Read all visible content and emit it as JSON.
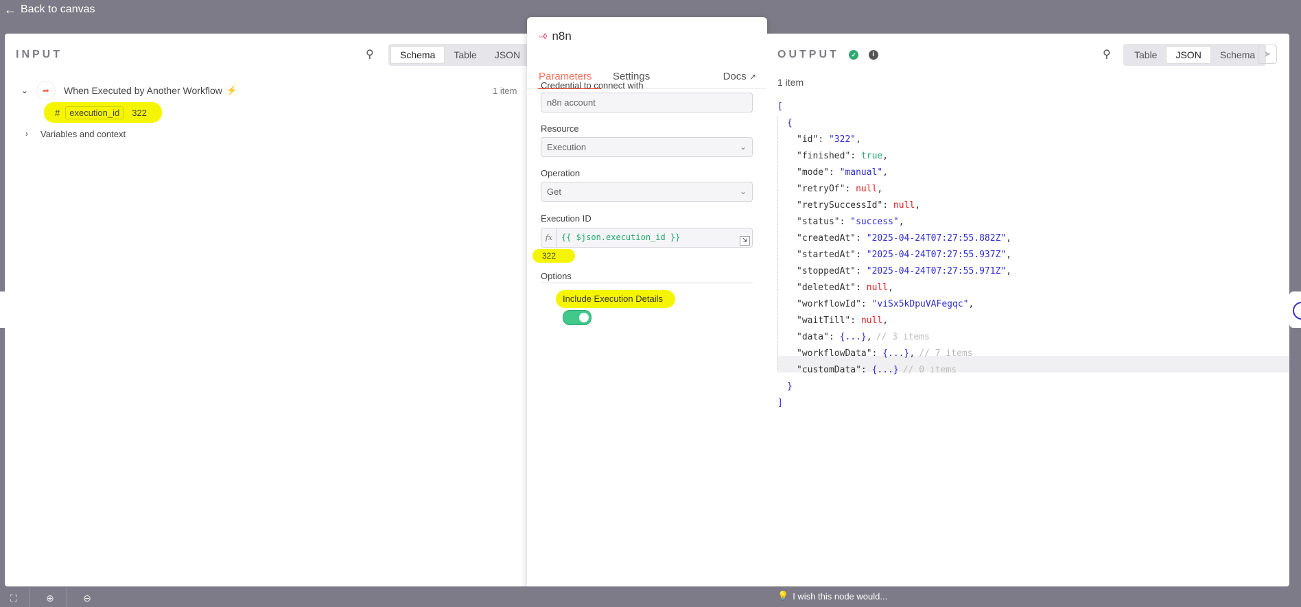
{
  "header": {
    "back_label": "Back to canvas"
  },
  "input": {
    "title": "INPUT",
    "views": [
      "Schema",
      "Table",
      "JSON"
    ],
    "active_view": "Schema",
    "trigger_name": "When Executed by Another Workflow",
    "item_count": "1 item",
    "field_type_glyph": "#",
    "field_name": "execution_id",
    "field_value": "322",
    "variables_label": "Variables and context"
  },
  "node": {
    "name": "n8n",
    "tabs": [
      "Parameters",
      "Settings"
    ],
    "active_tab": "Parameters",
    "docs_label": "Docs",
    "credential_label": "Credential to connect with",
    "credential_value": "n8n account",
    "resource_label": "Resource",
    "resource_value": "Execution",
    "operation_label": "Operation",
    "operation_value": "Get",
    "execution_id_label": "Execution ID",
    "execution_id_fx": "fx",
    "execution_id_expression": "{{ $json.execution_id }}",
    "execution_id_result": "322",
    "options_label": "Options",
    "include_details_label": "Include Execution Details",
    "include_details_on": true
  },
  "output": {
    "title": "OUTPUT",
    "views": [
      "Table",
      "JSON",
      "Schema"
    ],
    "active_view": "JSON",
    "item_count": "1 item",
    "json": {
      "open": "[",
      "obj_open": "{",
      "fields": [
        {
          "key": "\"id\"",
          "value": "\"322\"",
          "kind": "str"
        },
        {
          "key": "\"finished\"",
          "value": "true",
          "kind": "true"
        },
        {
          "key": "\"mode\"",
          "value": "\"manual\"",
          "kind": "str"
        },
        {
          "key": "\"retryOf\"",
          "value": "null",
          "kind": "null"
        },
        {
          "key": "\"retrySuccessId\"",
          "value": "null",
          "kind": "null"
        },
        {
          "key": "\"status\"",
          "value": "\"success\"",
          "kind": "str"
        },
        {
          "key": "\"createdAt\"",
          "value": "\"2025-04-24T07:27:55.882Z\"",
          "kind": "str"
        },
        {
          "key": "\"startedAt\"",
          "value": "\"2025-04-24T07:27:55.937Z\"",
          "kind": "str"
        },
        {
          "key": "\"stoppedAt\"",
          "value": "\"2025-04-24T07:27:55.971Z\"",
          "kind": "str"
        },
        {
          "key": "\"deletedAt\"",
          "value": "null",
          "kind": "null"
        },
        {
          "key": "\"workflowId\"",
          "value": "\"viSx5kDpuVAFegqc\"",
          "kind": "str"
        },
        {
          "key": "\"waitTill\"",
          "value": "null",
          "kind": "null"
        },
        {
          "key": "\"data\"",
          "value": "{...}",
          "kind": "obj",
          "comment": "// 3 items"
        },
        {
          "key": "\"workflowData\"",
          "value": "{...}",
          "kind": "obj",
          "comment": "// 7 items"
        },
        {
          "key": "\"customData\"",
          "value": "{...}",
          "kind": "objlast",
          "comment": "// 0 items"
        }
      ],
      "obj_close": "}",
      "close": "]"
    }
  },
  "footer": {
    "wish_label": "I wish this node would..."
  }
}
